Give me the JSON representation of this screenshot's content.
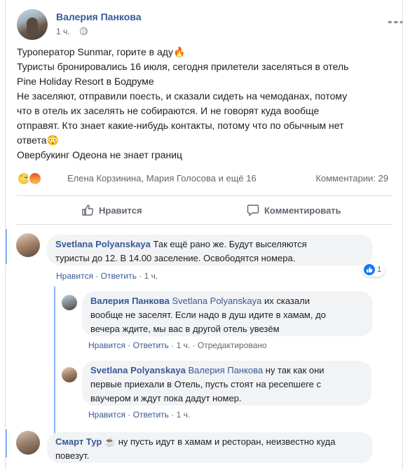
{
  "post": {
    "author": "Валерия Панкова",
    "time": "1 ч.",
    "lines": [
      "Туроператор Sunmar, горите в аду🔥",
      "Туристы бронировались 16 июля, сегодня прилетели заселяться в отель",
      "Pine Holiday Resort в Бодруме",
      "Не заселяют, отправили поесть, и сказали сидеть на чемоданах, потому",
      "что в отель их заселять не собираются. И не говорят куда вообще",
      "отправят. Кто знает какие-нибудь контакты, потому что по обычным нет",
      "ответа😳",
      "Овербукинг Одеона не знает границ"
    ],
    "reactions_names": "Елена Корзинина, Мария Голосова и ещё 16",
    "comments_count": "Комментарии: 29",
    "like_label": "Нравится",
    "comment_label": "Комментировать"
  },
  "comments": [
    {
      "author": "Svetlana Polyanskaya",
      "text_line1": "Так ещё рано же. Будут выселяются",
      "text_line2": "туристы до 12. В 14.00 заселение. Освободятся номера.",
      "like": "Нравится",
      "dot": " · ",
      "reply": "Ответить",
      "time": "1 ч.",
      "likes_count": "1"
    },
    {
      "author": "Валерия Панкова",
      "mention": "Svetlana Polyanskaya",
      "text_line1": " их сказали",
      "text_line2": "вообще не заселят. Если надо в душ идите в хамам, до",
      "text_line3": "вечера ждите, мы вас в другой отель увезём",
      "like": "Нравится",
      "reply": "Ответить",
      "time": "1 ч.",
      "edited": "Отредактировано"
    },
    {
      "author": "Svetlana Polyanskaya",
      "mention": "Валерия Панкова",
      "text_line1": " ну так как они",
      "text_line2": "первые приехали в Отель, пусть стоят на ресепшеге с",
      "text_line3": "ваучером и ждут пока дадут номер.",
      "like": "Нравится",
      "reply": "Ответить",
      "time": "1 ч."
    },
    {
      "author": "Смарт Тур",
      "author_emoji": "☕",
      "text_line1": " ну пусть идут в хамам и ресторан, неизвестно куда",
      "text_line2": "повезут."
    }
  ],
  "colors": {
    "link": "#385898",
    "muted": "#606770",
    "bubble": "#f2f3f5",
    "thread": "#8ab4f8",
    "like_blue": "#1877f2"
  }
}
